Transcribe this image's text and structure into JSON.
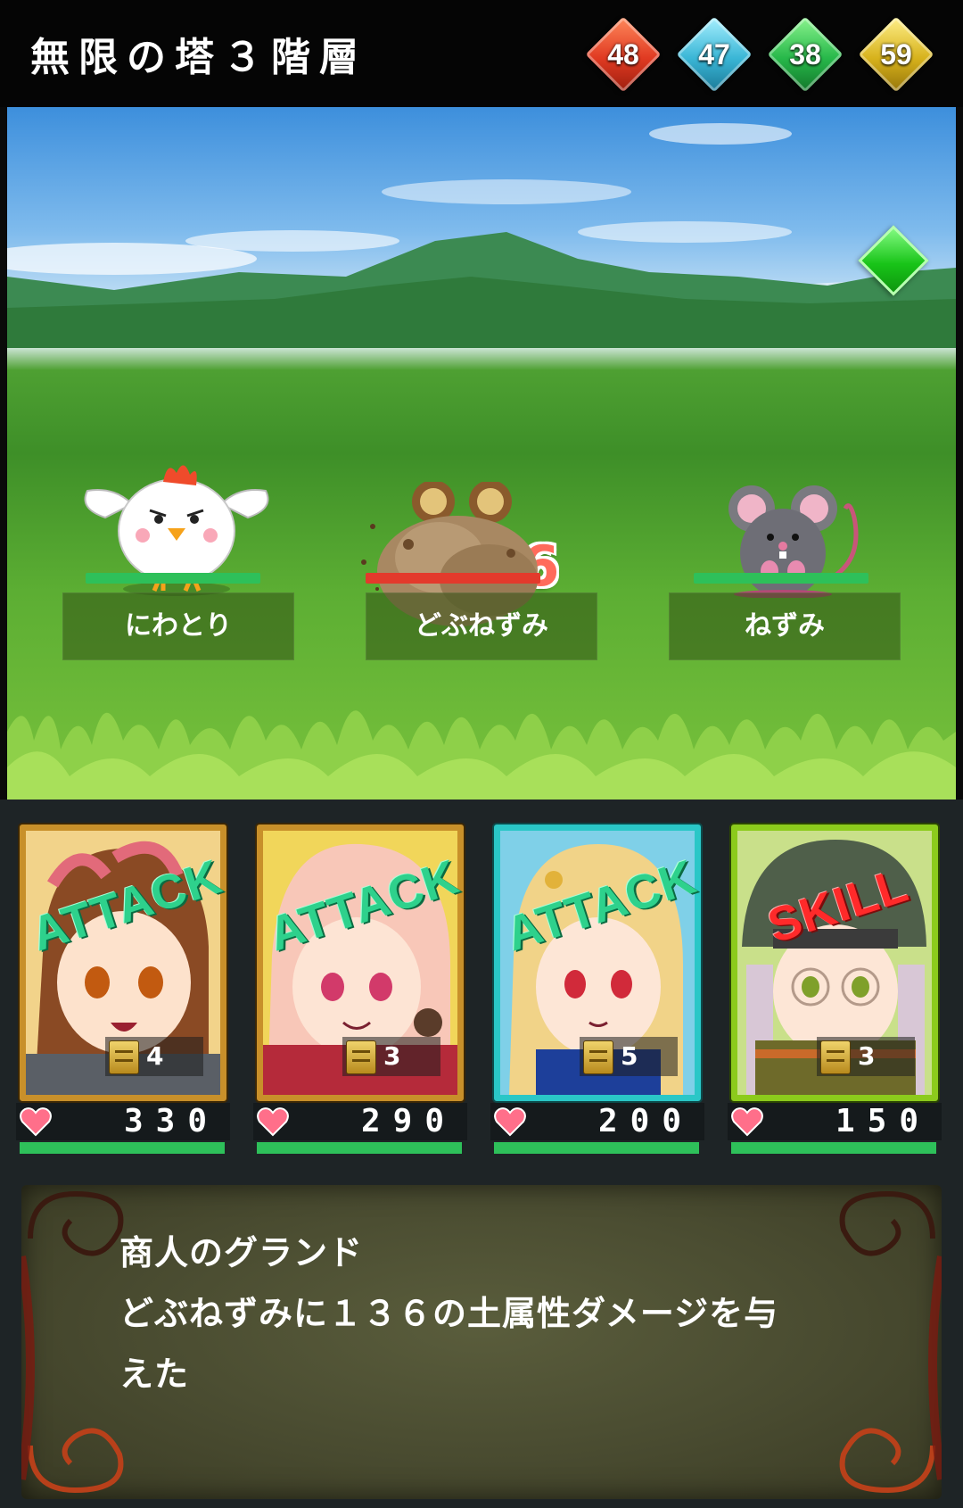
{
  "header": {
    "title": "無限の塔３階層",
    "gems": [
      {
        "name": "red-gem",
        "value": "48",
        "color": "#e84a2a"
      },
      {
        "name": "blue-gem",
        "value": "47",
        "color": "#3ab6d6"
      },
      {
        "name": "green-gem",
        "value": "38",
        "color": "#27b84a"
      },
      {
        "name": "yellow-gem",
        "value": "59",
        "color": "#d7b21c"
      }
    ]
  },
  "battle": {
    "damage_popup": "136",
    "enemies": [
      {
        "name": "にわとり",
        "hp_fraction": 1.0,
        "sprite": "chicken"
      },
      {
        "name": "どぶねずみ",
        "hp_fraction": 0.0,
        "sprite": "sewer-rat"
      },
      {
        "name": "ねずみ",
        "hp_fraction": 1.0,
        "sprite": "mouse"
      }
    ]
  },
  "party": [
    {
      "action": "ATTACK",
      "cost": "4",
      "hp": "330",
      "frame": "gold",
      "hp_fraction": 1.0
    },
    {
      "action": "ATTACK",
      "cost": "3",
      "hp": "290",
      "frame": "gold",
      "hp_fraction": 1.0
    },
    {
      "action": "ATTACK",
      "cost": "5",
      "hp": "200",
      "frame": "teal",
      "hp_fraction": 1.0
    },
    {
      "action": "SKILL",
      "cost": "3",
      "hp": "150",
      "frame": "lime",
      "hp_fraction": 1.0
    }
  ],
  "message": {
    "speaker": "商人のグランド",
    "line1": "どぶねずみに１３６の土属性ダメージを与",
    "line2": "えた"
  }
}
